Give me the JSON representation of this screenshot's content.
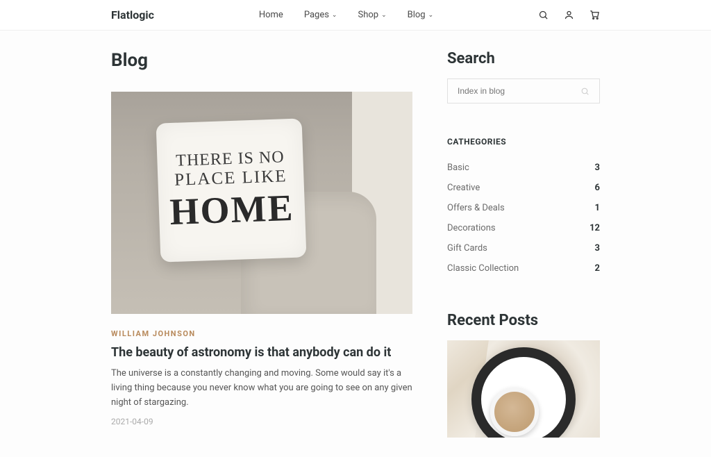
{
  "brand": "Flatlogic",
  "nav": {
    "home": "Home",
    "pages": "Pages",
    "shop": "Shop",
    "blog": "Blog"
  },
  "page_title": "Blog",
  "post": {
    "pillow_line1": "THERE IS NO",
    "pillow_line2": "PLACE LIKE",
    "pillow_line3": "HOME",
    "author": "WILLIAM JOHNSON",
    "title": "The beauty of astronomy is that anybody can do it",
    "excerpt": "The universe is a constantly changing and moving. Some would say it's a living thing because you never know what you are going to see on any given night of stargazing.",
    "date": "2021-04-09"
  },
  "sidebar": {
    "search_heading": "Search",
    "search_placeholder": "Index in blog",
    "categories_heading": "CATHEGORIES",
    "categories": [
      {
        "label": "Basic",
        "count": "3"
      },
      {
        "label": "Creative",
        "count": "6"
      },
      {
        "label": "Offers & Deals",
        "count": "1"
      },
      {
        "label": "Decorations",
        "count": "12"
      },
      {
        "label": "Gift Cards",
        "count": "3"
      },
      {
        "label": "Classic Collection",
        "count": "2"
      }
    ],
    "recent_heading": "Recent Posts"
  }
}
